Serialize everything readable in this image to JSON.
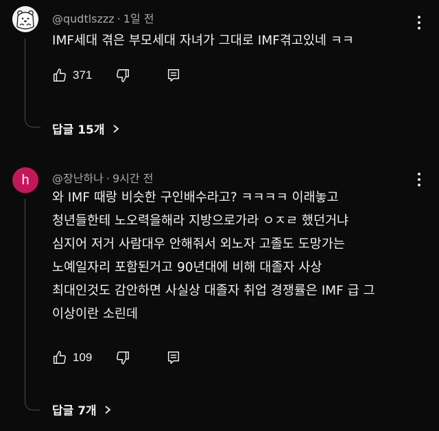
{
  "comments": [
    {
      "author": "@qudtlszzz",
      "separator": "·",
      "time": "1일 전",
      "avatar": {
        "kind": "image",
        "icon": "polar-bear-icon"
      },
      "text_lines": [
        "IMF세대 겪은 부모세대 자녀가 그대로 IMF겪고있네 ㅋㅋ"
      ],
      "likes": "371",
      "replies_label": "답글 15개"
    },
    {
      "author": "@장난하나",
      "separator": "·",
      "time": "9시간 전",
      "avatar": {
        "kind": "letter",
        "letter": "h",
        "color": "#c2185b"
      },
      "text_lines": [
        "와 IMF 때랑 비슷한 구인배수라고? ㅋㅋㅋㅋ 이래놓고",
        "청년들한테 노오력을해라 지방으로가라 ㅇㅈㄹ 했던거냐",
        "심지어 저거 사람대우 안해줘서 외노자 고졸도 도망가는",
        "노예일자리 포함된거고 90년대에 비해 대졸자 사상",
        "최대인것도 감안하면 사실상 대졸자 취업 경쟁률은 IMF 급 그",
        "이상이란 소린데"
      ],
      "likes": "109",
      "replies_label": "답글 7개"
    }
  ],
  "theme": {
    "background": "#0b0b0b",
    "text": "#f1f1f1",
    "meta": "#aaaaaa"
  }
}
